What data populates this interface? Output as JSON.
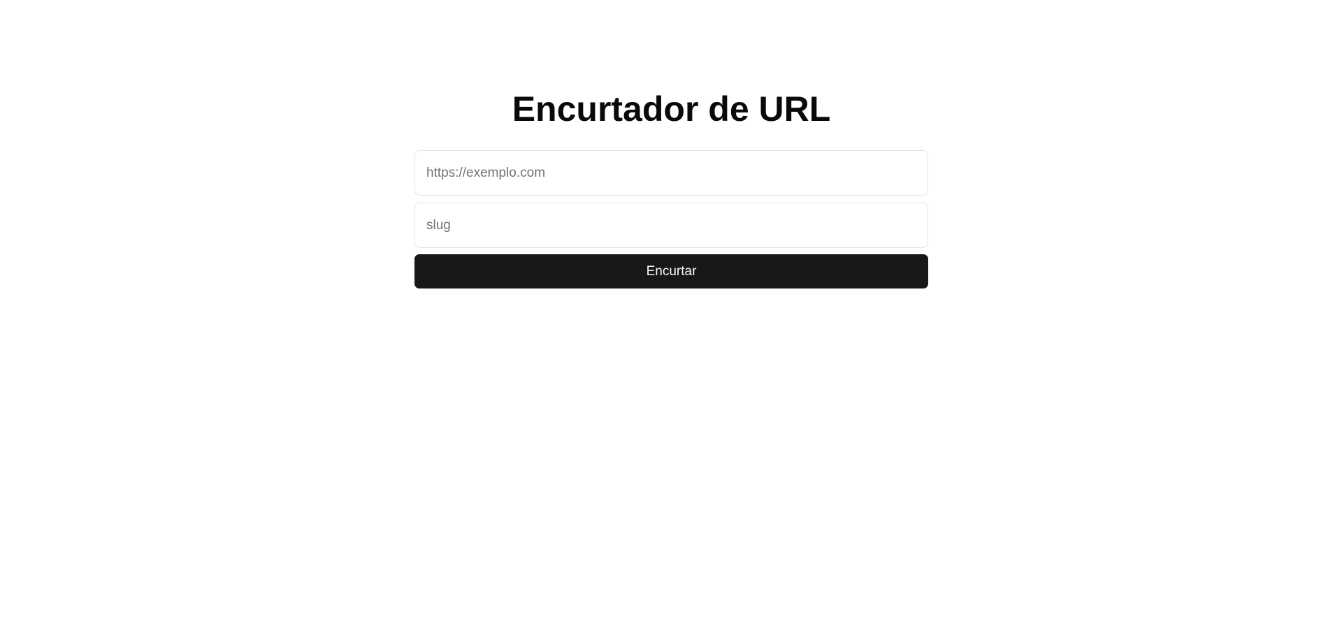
{
  "header": {
    "title": "Encurtador de URL"
  },
  "form": {
    "url_input": {
      "value": "",
      "placeholder": "https://exemplo.com"
    },
    "slug_input": {
      "value": "",
      "placeholder": "slug"
    },
    "submit_label": "Encurtar"
  },
  "colors": {
    "background": "#ffffff",
    "title": "#0a0a0a",
    "input_border": "#e4e4e7",
    "placeholder": "#71717a",
    "button_bg": "#18181b",
    "button_text": "#fafafa"
  }
}
